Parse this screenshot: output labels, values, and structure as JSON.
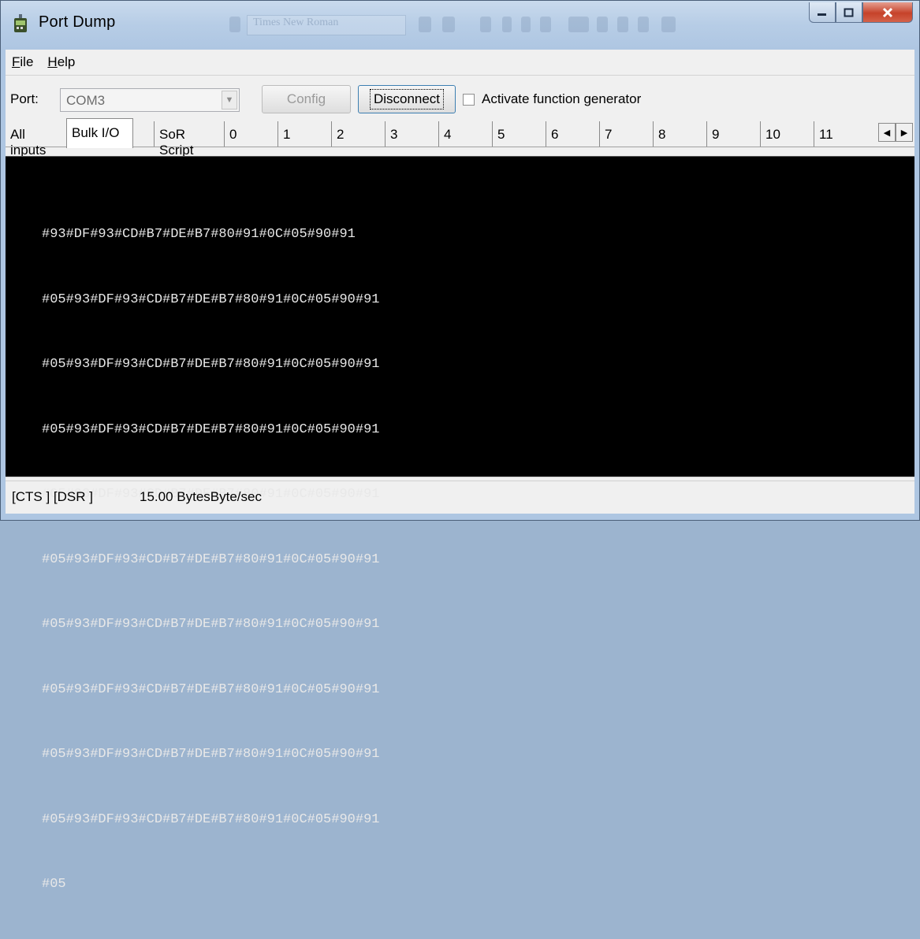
{
  "window": {
    "title": "Port Dump",
    "background_title_hint": "Times New Roman"
  },
  "menu": {
    "items": [
      {
        "label": "File",
        "mnemonic": "F",
        "rest": "ile"
      },
      {
        "label": "Help",
        "mnemonic": "H",
        "rest": "elp"
      }
    ]
  },
  "toolbar": {
    "port_label": "Port:",
    "port_value": "COM3",
    "config_label": "Config",
    "disconnect_label": "Disconnect",
    "function_generator_label": "Activate function generator",
    "function_generator_checked": false
  },
  "tabs": {
    "active": "Bulk I/O",
    "items": [
      "All inputs",
      "Bulk I/O",
      "SoR Script",
      "0",
      "1",
      "2",
      "3",
      "4",
      "5",
      "6",
      "7",
      "8",
      "9",
      "10",
      "11"
    ]
  },
  "terminal": {
    "lines": [
      "#93#DF#93#CD#B7#DE#B7#80#91#0C#05#90#91",
      "#05#93#DF#93#CD#B7#DE#B7#80#91#0C#05#90#91",
      "#05#93#DF#93#CD#B7#DE#B7#80#91#0C#05#90#91",
      "#05#93#DF#93#CD#B7#DE#B7#80#91#0C#05#90#91",
      "#05#93#DF#93#CD#B7#DE#B7#80#91#0C#05#90#91",
      "#05#93#DF#93#CD#B7#DE#B7#80#91#0C#05#90#91",
      "#05#93#DF#93#CD#B7#DE#B7#80#91#0C#05#90#91",
      "#05#93#DF#93#CD#B7#DE#B7#80#91#0C#05#90#91",
      "#05#93#DF#93#CD#B7#DE#B7#80#91#0C#05#90#91",
      "#05#93#DF#93#CD#B7#DE#B7#80#91#0C#05#90#91",
      "#05"
    ]
  },
  "status": {
    "signals": "[CTS ] [DSR ]",
    "rate": "15.00 BytesByte/sec"
  },
  "colors": {
    "terminal_bg": "#000000",
    "terminal_fg": "#e8e8e8",
    "close_button": "#c6422a"
  }
}
